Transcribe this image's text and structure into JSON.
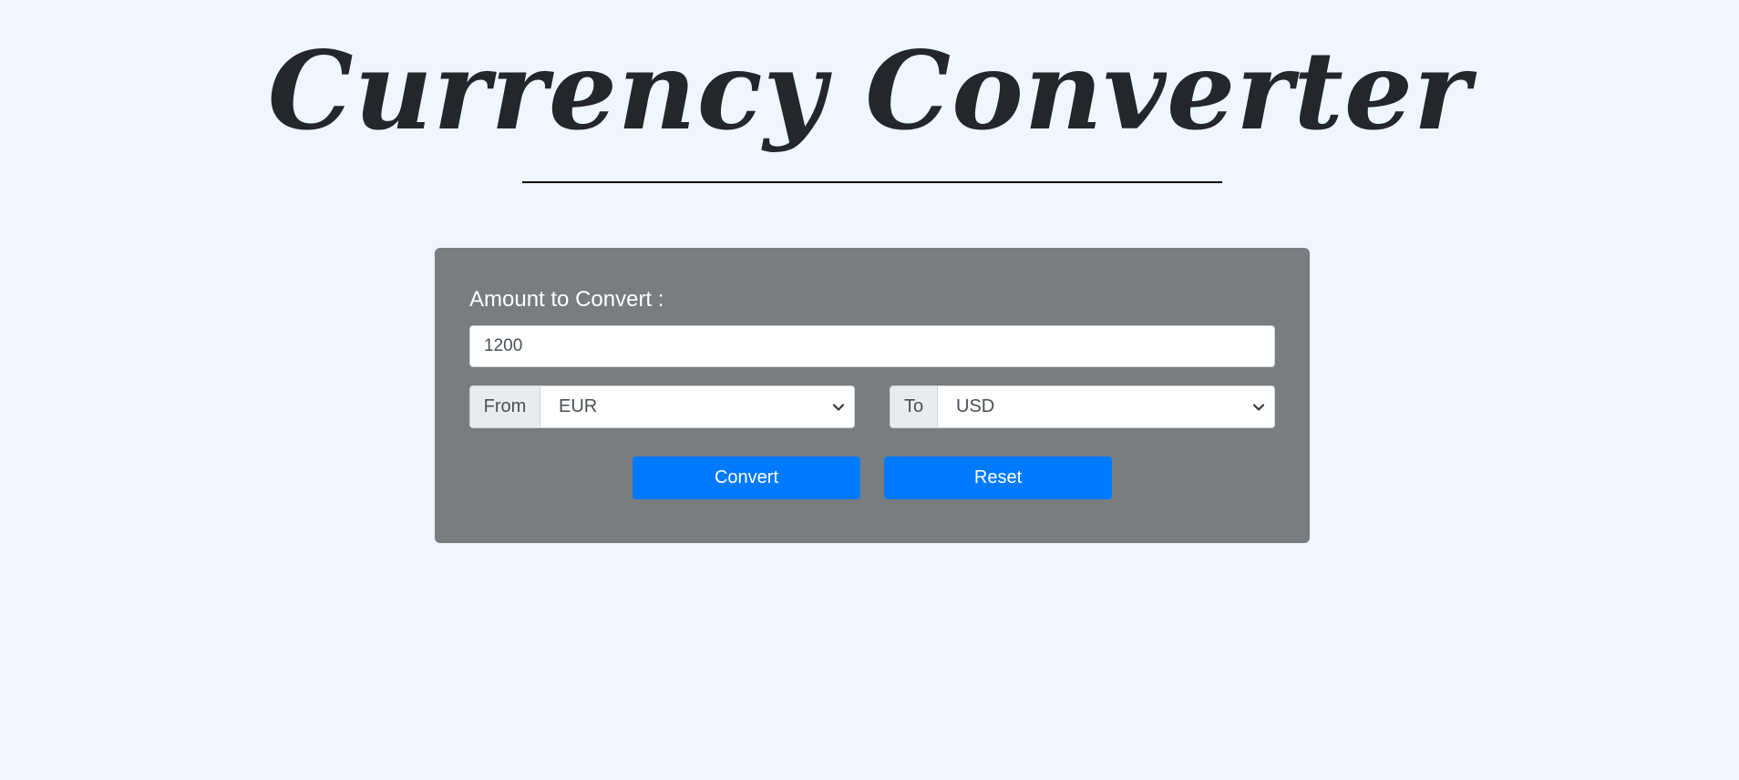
{
  "header": {
    "title": "Currency Converter"
  },
  "form": {
    "amount_label": "Amount to Convert :",
    "amount_value": "1200",
    "from": {
      "label": "From",
      "selected": "EUR"
    },
    "to": {
      "label": "To",
      "selected": "USD"
    },
    "convert_label": "Convert",
    "reset_label": "Reset"
  },
  "colors": {
    "background": "#eef6ff",
    "card": "#797d80",
    "button": "#007bff",
    "title": "#23272b"
  },
  "icons": {
    "select_arrow": "chevron-down-icon"
  }
}
